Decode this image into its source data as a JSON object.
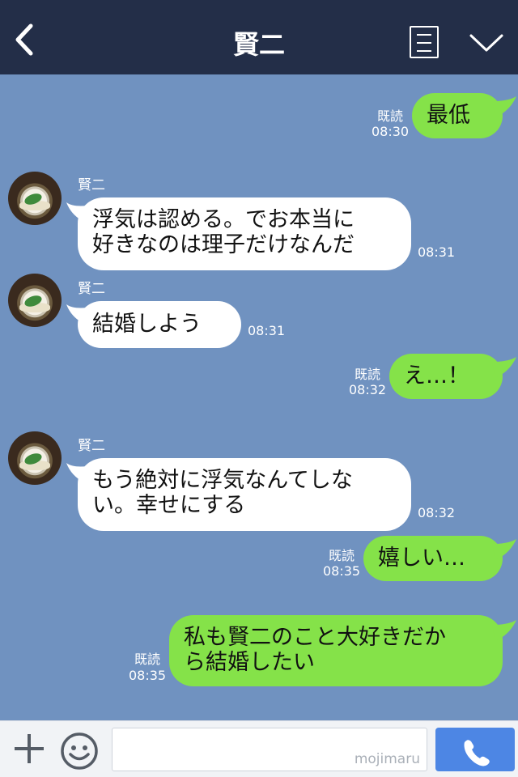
{
  "header": {
    "title": "賢二",
    "back_icon": "chevron-left-icon",
    "menu_icon": "list-icon",
    "collapse_icon": "chevron-down-icon"
  },
  "colors": {
    "header_bg": "#232e48",
    "chat_bg": "#7092c0",
    "outgoing_bubble": "#85e249",
    "incoming_bubble": "#ffffff",
    "send_button": "#4d86e4"
  },
  "messages": [
    {
      "direction": "out",
      "text": "最低",
      "read": "既読",
      "time": "08:30"
    },
    {
      "direction": "in",
      "sender": "賢二",
      "lines": [
        "浮気は認める。でお本当に",
        "好きなのは理子だけなんだ"
      ],
      "time": "08:31"
    },
    {
      "direction": "in",
      "sender": "賢二",
      "text": "結婚しよう",
      "time": "08:31"
    },
    {
      "direction": "out",
      "text": "え…！",
      "read": "既読",
      "time": "08:32"
    },
    {
      "direction": "in",
      "sender": "賢二",
      "lines": [
        "もう絶対に浮気なんてしな",
        "い。幸せにする"
      ],
      "time": "08:32"
    },
    {
      "direction": "out",
      "text": "嬉しい…",
      "read": "既読",
      "time": "08:35"
    },
    {
      "direction": "out",
      "lines": [
        "私も賢二のこと大好きだか",
        "ら結婚したい"
      ],
      "read": "既読",
      "time": "08:35"
    }
  ],
  "footer": {
    "watermark": "mojimaru",
    "plus_icon": "plus-icon",
    "sticker_icon": "smiley-icon",
    "call_icon": "phone-icon"
  }
}
